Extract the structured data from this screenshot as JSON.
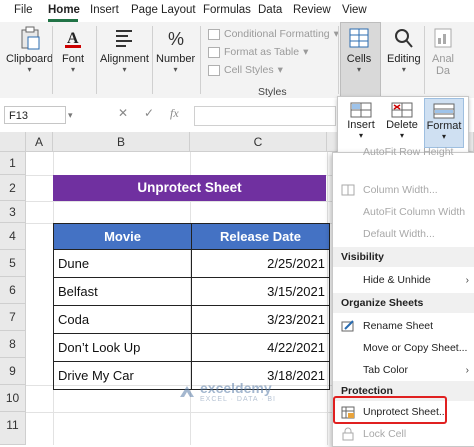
{
  "tabs": [
    "File",
    "Home",
    "Insert",
    "Page Layout",
    "Formulas",
    "Data",
    "Review",
    "View"
  ],
  "ribbon": {
    "clipboard": "Clipboard",
    "font": "Font",
    "alignment": "Alignment",
    "number": "Number",
    "conditional_formatting": "Conditional Formatting",
    "format_as_table": "Format as Table",
    "cell_styles": "Cell Styles",
    "styles_group": "Styles",
    "cells": "Cells",
    "editing": "Editing",
    "analyze": "Anal",
    "analyze2": "Da"
  },
  "formula_bar": {
    "name_box": "F13",
    "cancel": "✕",
    "enter": "✓",
    "fx": "fx"
  },
  "columns": [
    "A",
    "B",
    "C"
  ],
  "rows": [
    "1",
    "2",
    "3",
    "4",
    "5",
    "6",
    "7",
    "8",
    "9",
    "10",
    "11"
  ],
  "sheet": {
    "title": "Unprotect Sheet",
    "headers": [
      "Movie",
      "Release Date"
    ],
    "rows": [
      {
        "movie": "Dune",
        "date": "2/25/2021"
      },
      {
        "movie": "Belfast",
        "date": "3/15/2021"
      },
      {
        "movie": "Coda",
        "date": "3/23/2021"
      },
      {
        "movie": "Don’t Look Up",
        "date": "4/22/2021"
      },
      {
        "movie": "Drive My Car",
        "date": "3/18/2021"
      }
    ]
  },
  "popup": {
    "insert": "Insert",
    "delete": "Delete",
    "format": "Format"
  },
  "menu": {
    "cut_top": "AutoFit Row Height",
    "column_width": "Column Width...",
    "autofit_column": "AutoFit Column Width",
    "default_width": "Default Width...",
    "visibility": "Visibility",
    "hide_unhide": "Hide & Unhide",
    "organize": "Organize Sheets",
    "rename": "Rename Sheet",
    "move_copy": "Move or Copy Sheet...",
    "tab_color": "Tab Color",
    "protection": "Protection",
    "unprotect": "Unprotect Sheet...",
    "lock_cell": "Lock Cell"
  },
  "watermark": {
    "name": "exceldemy",
    "tagline": "EXCEL · DATA · BI"
  },
  "colors": {
    "excel_green": "#217346",
    "banner_purple": "#7030a0",
    "header_blue": "#4472c4",
    "highlight_red": "#e02020"
  }
}
